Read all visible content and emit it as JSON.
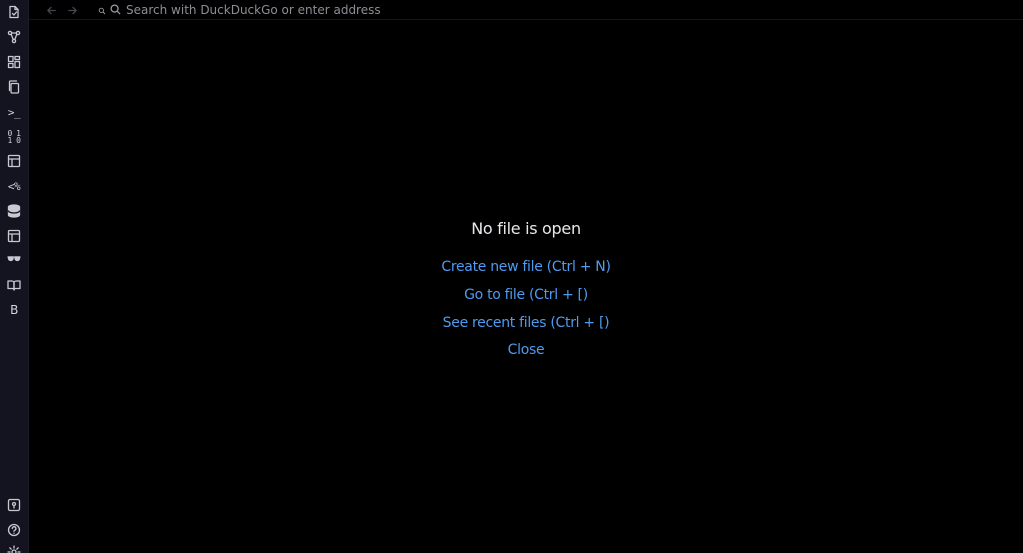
{
  "ribbon": {
    "items": [
      {
        "icon": "open-file-icon"
      },
      {
        "icon": "graph-icon"
      },
      {
        "icon": "canvas-icon"
      },
      {
        "icon": "copy-icon"
      },
      {
        "icon": "terminal-icon",
        "glyph": ">_"
      },
      {
        "icon": "binary-icon",
        "glyph": "01"
      },
      {
        "icon": "template-icon"
      },
      {
        "icon": "templater-icon",
        "glyph": "<%"
      },
      {
        "icon": "database-icon"
      },
      {
        "icon": "layout-icon"
      },
      {
        "icon": "glasses-icon"
      },
      {
        "icon": "book-open-icon"
      },
      {
        "icon": "bold-b-icon",
        "glyph": "B"
      }
    ],
    "bottom_items": [
      {
        "icon": "vault-icon"
      },
      {
        "icon": "help-icon"
      },
      {
        "icon": "settings-icon"
      }
    ]
  },
  "topbar": {
    "back_icon": "arrow-left-icon",
    "forward_icon": "arrow-right-icon",
    "address_placeholder": "Search with DuckDuckGo or enter address"
  },
  "empty_state": {
    "title": "No file is open",
    "actions": [
      {
        "label": "Create new file (Ctrl + N)"
      },
      {
        "label": "Go to file (Ctrl + [)"
      },
      {
        "label": "See recent files (Ctrl + [)"
      },
      {
        "label": "Close"
      }
    ],
    "link_color": "#4f9bf0"
  },
  "colors": {
    "background": "#000000",
    "ribbon": "#141420",
    "title_text": "#e8e8ec"
  }
}
